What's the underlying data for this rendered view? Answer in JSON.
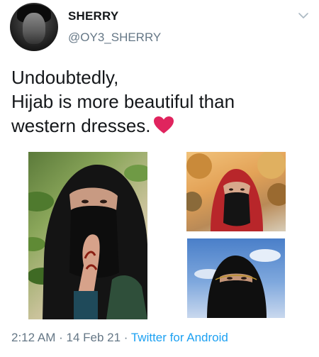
{
  "user": {
    "display_name": "SHERRY",
    "handle": "@OY3_SHERRY"
  },
  "tweet": {
    "lines": [
      "Undoubtedly,",
      "Hijab is more beautiful than",
      "western dresses."
    ],
    "emoji": "heart-icon"
  },
  "media": [
    {
      "description_icon": "photo-woman-black-hijab-niqab"
    },
    {
      "description_icon": "photo-woman-red-hijab-niqab"
    },
    {
      "description_icon": "photo-woman-black-niqab-sky"
    }
  ],
  "footer": {
    "time": "2:12 AM",
    "separator": " · ",
    "date": "14 Feb 21",
    "source": "Twitter for Android"
  },
  "colors": {
    "secondary_text": "#657786",
    "link_blue": "#1da1f2",
    "heart_red": "#e0245e"
  }
}
